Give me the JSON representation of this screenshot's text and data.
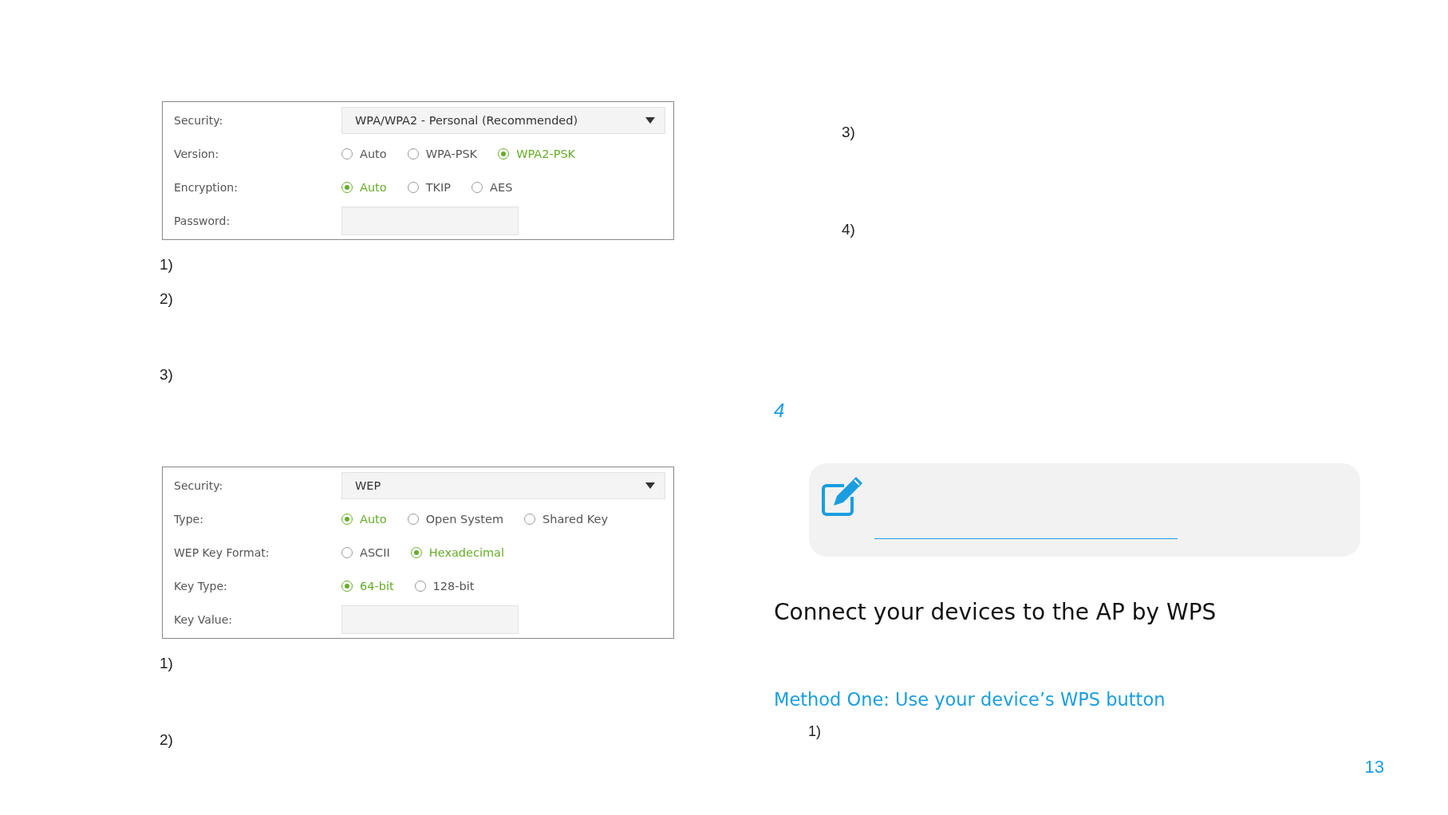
{
  "left_column": [
    {
      "kind": "form",
      "rows": [
        {
          "kind": "select",
          "label": "Security:",
          "value": "WPA/WPA2 - Personal (Recommended)"
        },
        {
          "kind": "radio",
          "label": "Version:",
          "options": [
            {
              "label": "Auto",
              "selected": false
            },
            {
              "label": "WPA-PSK",
              "selected": false
            },
            {
              "label": "WPA2-PSK",
              "selected": true
            }
          ]
        },
        {
          "kind": "radio",
          "label": "Encryption:",
          "options": [
            {
              "label": "Auto",
              "selected": true
            },
            {
              "label": "TKIP",
              "selected": false
            },
            {
              "label": "AES",
              "selected": false
            }
          ]
        },
        {
          "kind": "input",
          "label": "Password:"
        }
      ]
    },
    {
      "kind": "step",
      "text": "1)"
    },
    {
      "kind": "step",
      "text": "2)"
    },
    {
      "kind": "step",
      "text": "3)"
    },
    {
      "kind": "form",
      "rows": [
        {
          "kind": "select",
          "label": "Security:",
          "value": "WEP"
        },
        {
          "kind": "radio",
          "label": "Type:",
          "options": [
            {
              "label": "Auto",
              "selected": true
            },
            {
              "label": "Open System",
              "selected": false
            },
            {
              "label": "Shared Key",
              "selected": false
            }
          ]
        },
        {
          "kind": "radio",
          "label": "WEP Key Format:",
          "options": [
            {
              "label": "ASCII",
              "selected": false
            },
            {
              "label": "Hexadecimal",
              "selected": true
            }
          ]
        },
        {
          "kind": "radio",
          "label": "Key Type:",
          "options": [
            {
              "label": "64-bit",
              "selected": true
            },
            {
              "label": "128-bit",
              "selected": false
            }
          ]
        },
        {
          "kind": "input",
          "label": "Key Value:"
        }
      ]
    },
    {
      "kind": "step",
      "text": "1)"
    },
    {
      "kind": "step",
      "text": "2)"
    }
  ],
  "right_column": [
    {
      "kind": "step",
      "text": "3)"
    },
    {
      "kind": "step",
      "text": "4)"
    },
    {
      "kind": "section_number",
      "text": "4"
    },
    {
      "kind": "note"
    },
    {
      "kind": "heading",
      "text": "Connect your devices to the AP by WPS"
    },
    {
      "kind": "subheading",
      "text": "Method One: Use your device’s WPS button"
    },
    {
      "kind": "substep",
      "text": "1)"
    },
    {
      "kind": "page_number",
      "text": "13"
    }
  ]
}
